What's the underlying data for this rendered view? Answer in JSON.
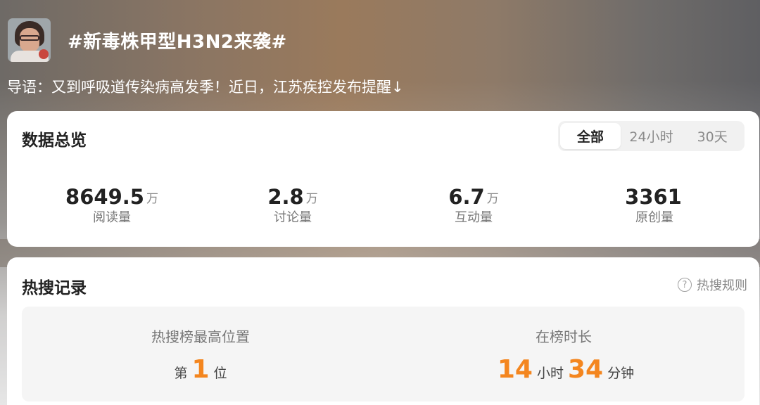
{
  "topic": {
    "title": "#新毒株甲型H3N2来袭#",
    "lead": "导语：又到呼吸道传染病高发季！近日，江苏疾控发布提醒↓"
  },
  "overview": {
    "title": "数据总览",
    "tabs": [
      "全部",
      "24小时",
      "30天"
    ],
    "active_tab": "全部",
    "stats": [
      {
        "value": "8649.5",
        "unit": "万",
        "label": "阅读量"
      },
      {
        "value": "2.8",
        "unit": "万",
        "label": "讨论量"
      },
      {
        "value": "6.7",
        "unit": "万",
        "label": "互动量"
      },
      {
        "value": "3361",
        "unit": "",
        "label": "原创量"
      }
    ]
  },
  "hot_record": {
    "title": "热搜记录",
    "rules_label": "热搜规则",
    "rules_icon": "?",
    "peak": {
      "label": "热搜榜最高位置",
      "prefix": "第",
      "value": "1",
      "suffix": "位"
    },
    "duration": {
      "label": "在榜时长",
      "hours": "14",
      "hours_unit": "小时",
      "minutes": "34",
      "minutes_unit": "分钟"
    }
  },
  "colors": {
    "accent": "#f4861f",
    "card": "#ffffff",
    "panel": "#f5f5f5"
  }
}
